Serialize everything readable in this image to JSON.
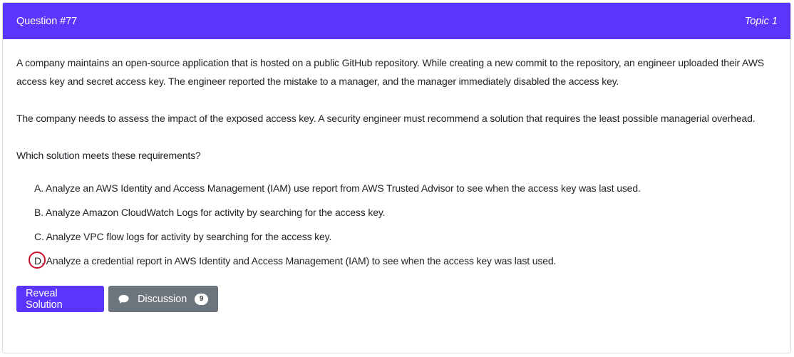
{
  "header": {
    "title": "Question #77",
    "topic": "Topic 1"
  },
  "question": {
    "paragraphs": [
      "A company maintains an open-source application that is hosted on a public GitHub repository. While creating a new commit to the repository, an engineer uploaded their AWS access key and secret access key. The engineer reported the mistake to a manager, and the manager immediately disabled the access key.",
      "The company needs to assess the impact of the exposed access key. A security engineer must recommend a solution that requires the least possible managerial overhead.",
      "Which solution meets these requirements?"
    ],
    "choices": [
      {
        "letter": "A.",
        "text": "Analyze an AWS Identity and Access Management (IAM) use report from AWS Trusted Advisor to see when the access key was last used."
      },
      {
        "letter": "B.",
        "text": "Analyze Amazon CloudWatch Logs for activity by searching for the access key."
      },
      {
        "letter": "C.",
        "text": "Analyze VPC flow logs for activity by searching for the access key."
      },
      {
        "letter": "D.",
        "text": "Analyze a credential report in AWS Identity and Access Management (IAM) to see when the access key was last used."
      }
    ]
  },
  "actions": {
    "reveal_label": "Reveal Solution",
    "discussion_label": "Discussion",
    "discussion_count": "9"
  },
  "colors": {
    "accent": "#5a36fc",
    "secondary": "#6c757d",
    "highlight_circle": "#c8102e"
  }
}
